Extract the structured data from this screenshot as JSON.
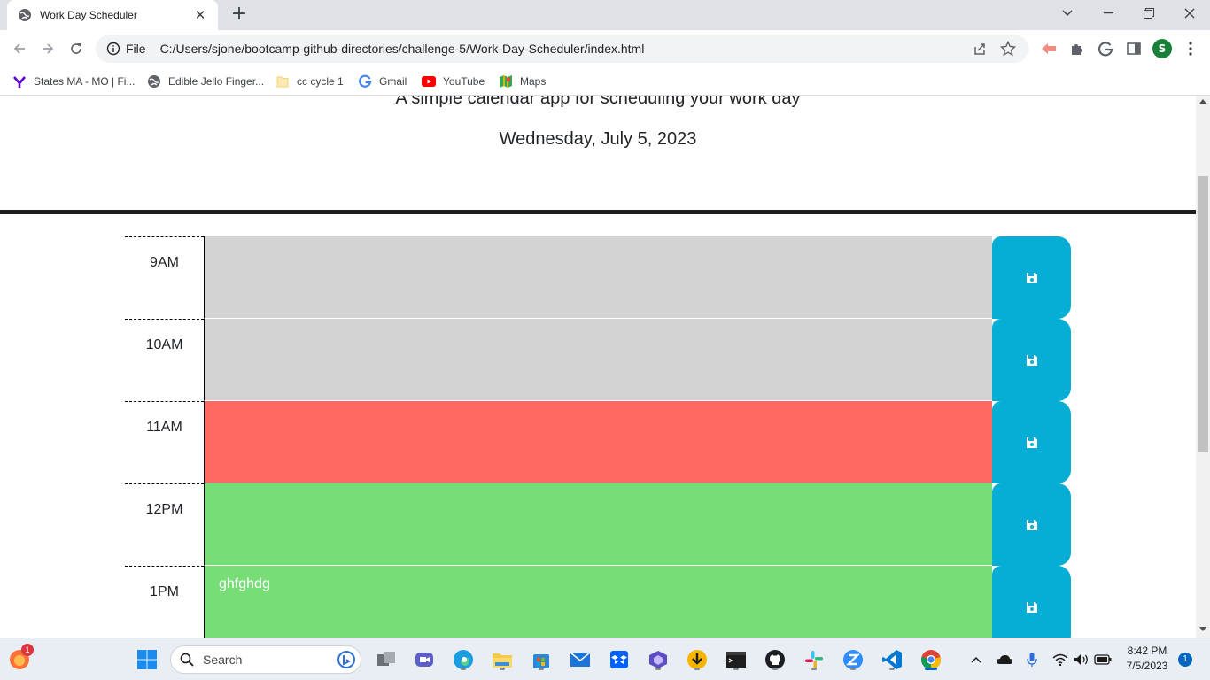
{
  "browser": {
    "tab_title": "Work Day Scheduler",
    "url_scheme_label": "File",
    "url": "C:/Users/sjone/bootcamp-github-directories/challenge-5/Work-Day-Scheduler/index.html",
    "profile_initial": "S",
    "bookmarks": [
      {
        "label": "States MA - MO | Fi...",
        "icon": "yahoo-icon"
      },
      {
        "label": "Edible Jello Finger...",
        "icon": "globe-icon"
      },
      {
        "label": "cc cycle 1",
        "icon": "folder-icon"
      },
      {
        "label": "Gmail",
        "icon": "google-icon"
      },
      {
        "label": "YouTube",
        "icon": "youtube-icon"
      },
      {
        "label": "Maps",
        "icon": "maps-icon"
      }
    ]
  },
  "page": {
    "lead": "A simple calendar app for scheduling your work day",
    "current_day": "Wednesday, July 5, 2023"
  },
  "hours": [
    {
      "label": "9AM",
      "text": "",
      "state": "past"
    },
    {
      "label": "10AM",
      "text": "",
      "state": "past"
    },
    {
      "label": "11AM",
      "text": "",
      "state": "present"
    },
    {
      "label": "12PM",
      "text": "",
      "state": "future"
    },
    {
      "label": "1PM",
      "text": "ghfghdg",
      "state": "future"
    }
  ],
  "colors": {
    "past": "#d3d3d3",
    "present": "#ff6961",
    "future": "#77dd77",
    "save_button": "#06aed5"
  },
  "taskbar": {
    "search_placeholder": "Search",
    "time": "8:42 PM",
    "date": "7/5/2023",
    "notification_count": "1",
    "firefox_badge": "1"
  }
}
